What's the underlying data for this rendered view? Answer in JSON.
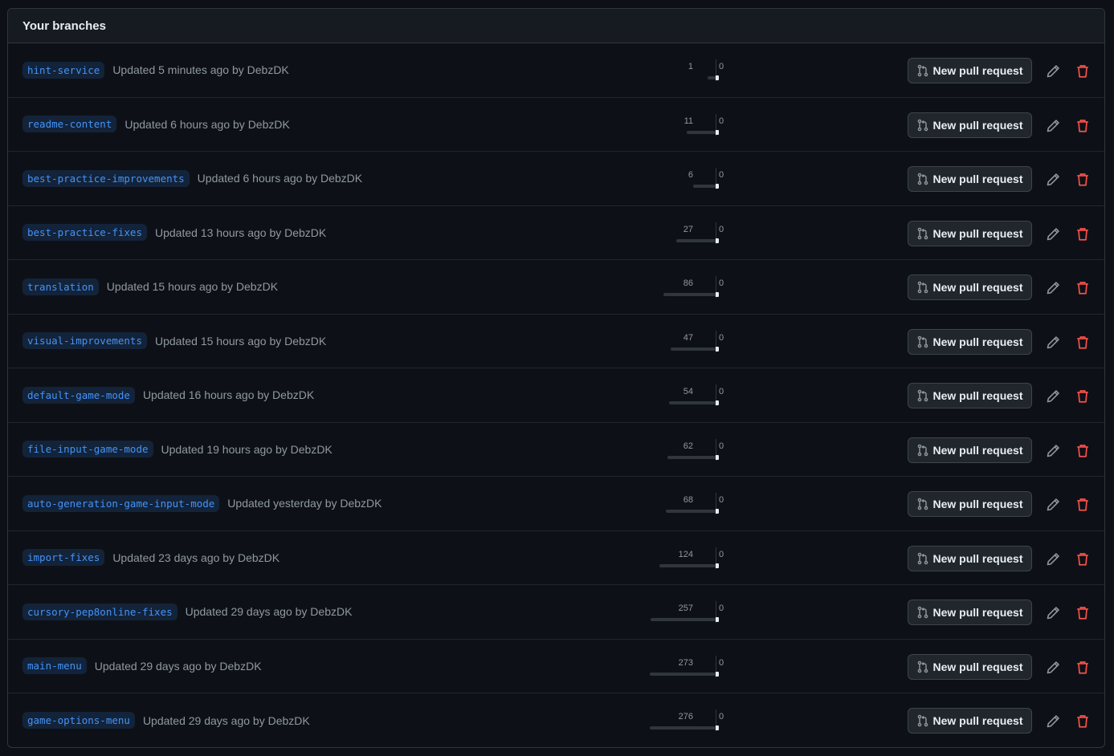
{
  "header": {
    "title": "Your branches"
  },
  "actions": {
    "new_pr_label": "New pull request",
    "pr_icon": "git-pull-request-icon",
    "edit_icon": "pencil-icon",
    "delete_icon": "trash-icon"
  },
  "colors": {
    "branch_text": "#4493f8",
    "delete_icon": "#f85149",
    "muted_text": "#9198a1",
    "background": "#0d1117"
  },
  "branches": [
    {
      "name": "hint-service",
      "updated": "Updated 5 minutes ago by DebzDK",
      "behind": 1,
      "ahead": 0
    },
    {
      "name": "readme-content",
      "updated": "Updated 6 hours ago by DebzDK",
      "behind": 11,
      "ahead": 0
    },
    {
      "name": "best-practice-improvements",
      "updated": "Updated 6 hours ago by DebzDK",
      "behind": 6,
      "ahead": 0
    },
    {
      "name": "best-practice-fixes",
      "updated": "Updated 13 hours ago by DebzDK",
      "behind": 27,
      "ahead": 0
    },
    {
      "name": "translation",
      "updated": "Updated 15 hours ago by DebzDK",
      "behind": 86,
      "ahead": 0
    },
    {
      "name": "visual-improvements",
      "updated": "Updated 15 hours ago by DebzDK",
      "behind": 47,
      "ahead": 0
    },
    {
      "name": "default-game-mode",
      "updated": "Updated 16 hours ago by DebzDK",
      "behind": 54,
      "ahead": 0
    },
    {
      "name": "file-input-game-mode",
      "updated": "Updated 19 hours ago by DebzDK",
      "behind": 62,
      "ahead": 0
    },
    {
      "name": "auto-generation-game-input-mode",
      "updated": "Updated yesterday by DebzDK",
      "behind": 68,
      "ahead": 0
    },
    {
      "name": "import-fixes",
      "updated": "Updated 23 days ago by DebzDK",
      "behind": 124,
      "ahead": 0
    },
    {
      "name": "cursory-pep8online-fixes",
      "updated": "Updated 29 days ago by DebzDK",
      "behind": 257,
      "ahead": 0
    },
    {
      "name": "main-menu",
      "updated": "Updated 29 days ago by DebzDK",
      "behind": 273,
      "ahead": 0
    },
    {
      "name": "game-options-menu",
      "updated": "Updated 29 days ago by DebzDK",
      "behind": 276,
      "ahead": 0
    }
  ]
}
